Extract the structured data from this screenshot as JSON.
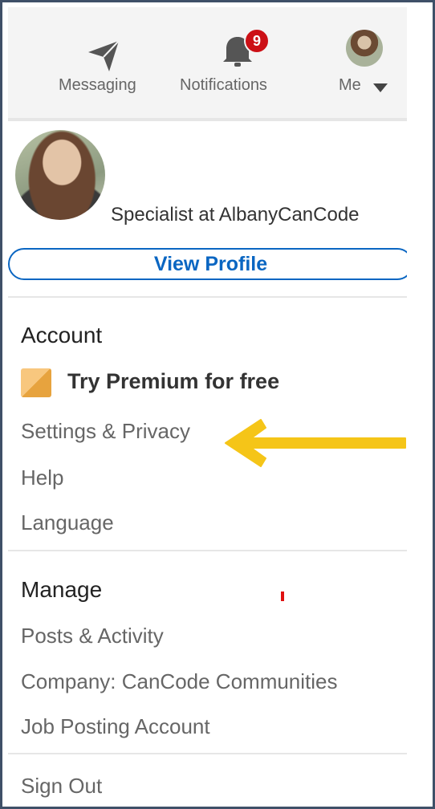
{
  "nav": {
    "messaging_label": "Messaging",
    "notifications_label": "Notifications",
    "notifications_count": "9",
    "me_label": "Me"
  },
  "profile": {
    "headline": "Specialist at AlbanyCanCode",
    "view_profile_label": "View Profile"
  },
  "account": {
    "title": "Account",
    "premium_label": "Try Premium for free",
    "items": [
      "Settings & Privacy",
      "Help",
      "Language"
    ]
  },
  "manage": {
    "title": "Manage",
    "items": [
      "Posts & Activity",
      "Company: CanCode Communities",
      "Job Posting Account"
    ]
  },
  "sign_out_label": "Sign Out",
  "colors": {
    "accent": "#0a66c2",
    "badge": "#cc1016",
    "arrow": "#f5c518",
    "premium": "#e7a33e"
  },
  "icons": {
    "messaging": "paper-plane-icon",
    "notifications": "bell-icon",
    "premium": "premium-badge-icon",
    "annotation": "left-arrow-icon"
  }
}
